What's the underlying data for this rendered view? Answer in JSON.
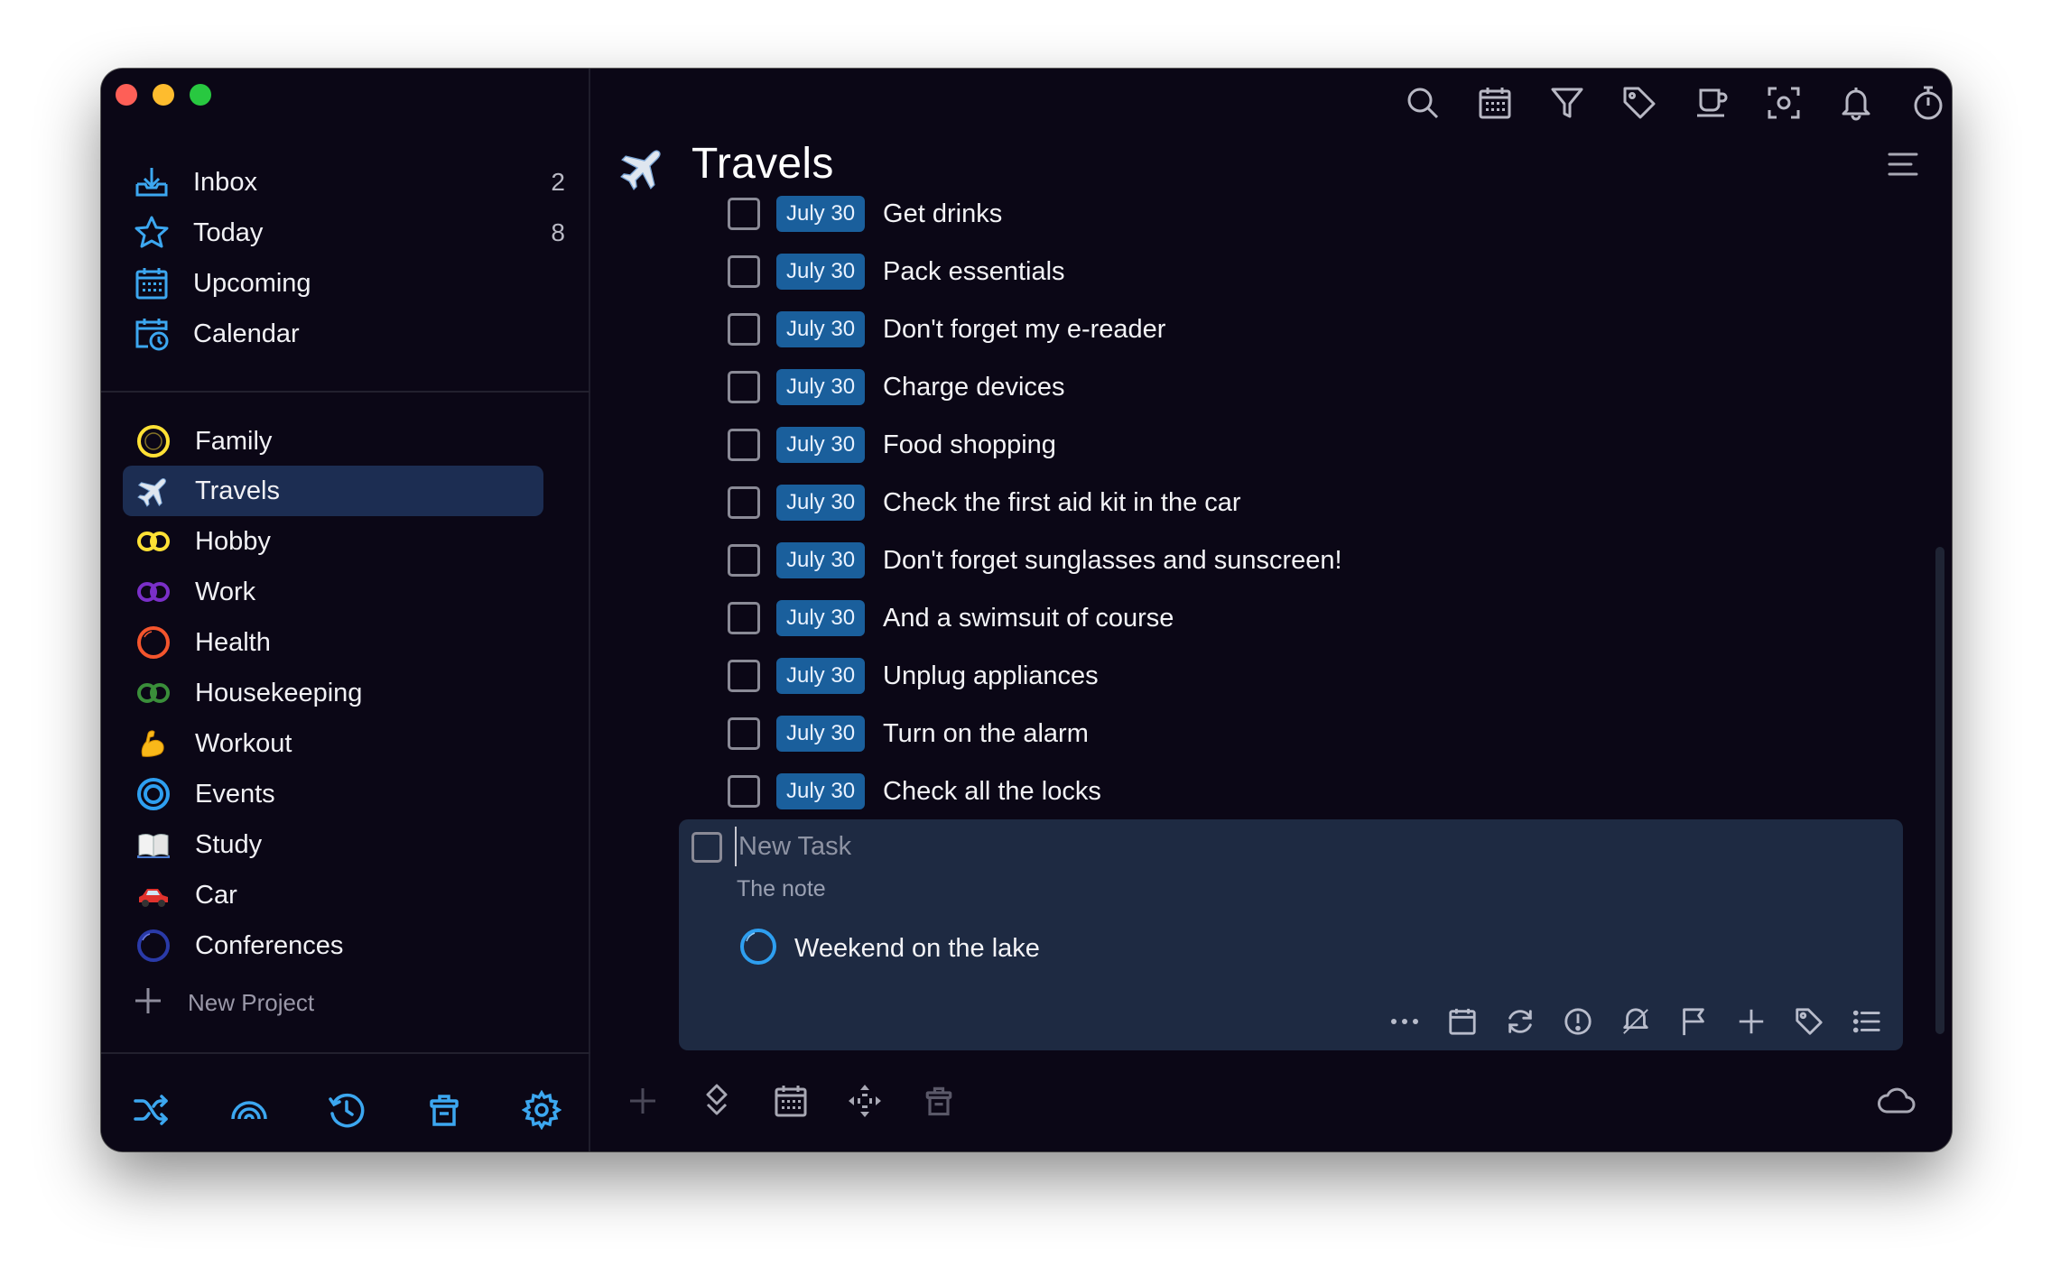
{
  "window": {
    "controls": [
      "close",
      "minimize",
      "zoom"
    ]
  },
  "sidebar": {
    "smart_lists": [
      {
        "label": "Inbox",
        "count": "2",
        "icon": "inbox-icon"
      },
      {
        "label": "Today",
        "count": "8",
        "icon": "star-icon"
      },
      {
        "label": "Upcoming",
        "count": "",
        "icon": "calendar-grid-icon"
      },
      {
        "label": "Calendar",
        "count": "",
        "icon": "calendar-clock-icon"
      }
    ],
    "projects": [
      {
        "label": "Family",
        "icon": "yellow-ring-icon"
      },
      {
        "label": "Travels",
        "icon": "airplane-icon"
      },
      {
        "label": "Hobby",
        "icon": "yellow-double-ring-icon"
      },
      {
        "label": "Work",
        "icon": "purple-double-ring-icon"
      },
      {
        "label": "Health",
        "icon": "orange-ring-icon"
      },
      {
        "label": "Housekeeping",
        "icon": "green-double-ring-icon"
      },
      {
        "label": "Workout",
        "icon": "flexed-biceps-icon"
      },
      {
        "label": "Events",
        "icon": "blue-target-icon"
      },
      {
        "label": "Study",
        "icon": "open-book-icon"
      },
      {
        "label": "Car",
        "icon": "red-car-icon"
      },
      {
        "label": "Conferences",
        "icon": "dark-blue-ring-icon"
      }
    ],
    "selected_project": "Travels",
    "new_project_label": "New Project",
    "bottom_buttons": [
      "shuffle-icon",
      "rainbow-icon",
      "history-icon",
      "trash-icon",
      "gear-icon"
    ]
  },
  "main": {
    "title": "Travels",
    "toolbar": [
      "search-icon",
      "calendar-icon",
      "filter-icon",
      "tag-icon",
      "coffee-icon",
      "focus-icon",
      "bell-icon",
      "timer-icon",
      "copy-icon"
    ],
    "tasks": [
      {
        "date": "July 30",
        "text": "Get drinks"
      },
      {
        "date": "July 30",
        "text": "Pack essentials"
      },
      {
        "date": "July 30",
        "text": "Don't forget my e-reader"
      },
      {
        "date": "July 30",
        "text": "Charge devices"
      },
      {
        "date": "July 30",
        "text": "Food shopping"
      },
      {
        "date": "July 30",
        "text": "Check the first aid kit in the car"
      },
      {
        "date": "July 30",
        "text": "Don't forget sunglasses and sunscreen!"
      },
      {
        "date": "July 30",
        "text": "And a swimsuit of course"
      },
      {
        "date": "July 30",
        "text": "Unplug appliances"
      },
      {
        "date": "July 30",
        "text": "Turn on the alarm"
      },
      {
        "date": "July 30",
        "text": "Check all the locks"
      }
    ],
    "editor": {
      "task_placeholder": "New Task",
      "note_placeholder": "The note",
      "project_label": "Weekend on the lake",
      "tools": [
        "more-icon",
        "date-icon",
        "repeat-icon",
        "priority-icon",
        "reminder-icon",
        "flag-icon",
        "subtask-icon",
        "tag-icon",
        "checklist-icon"
      ]
    },
    "bottom_bar": [
      "add-icon",
      "move-icon",
      "calendar-icon",
      "arrange-icon",
      "delete-icon",
      "cloud-icon"
    ]
  }
}
